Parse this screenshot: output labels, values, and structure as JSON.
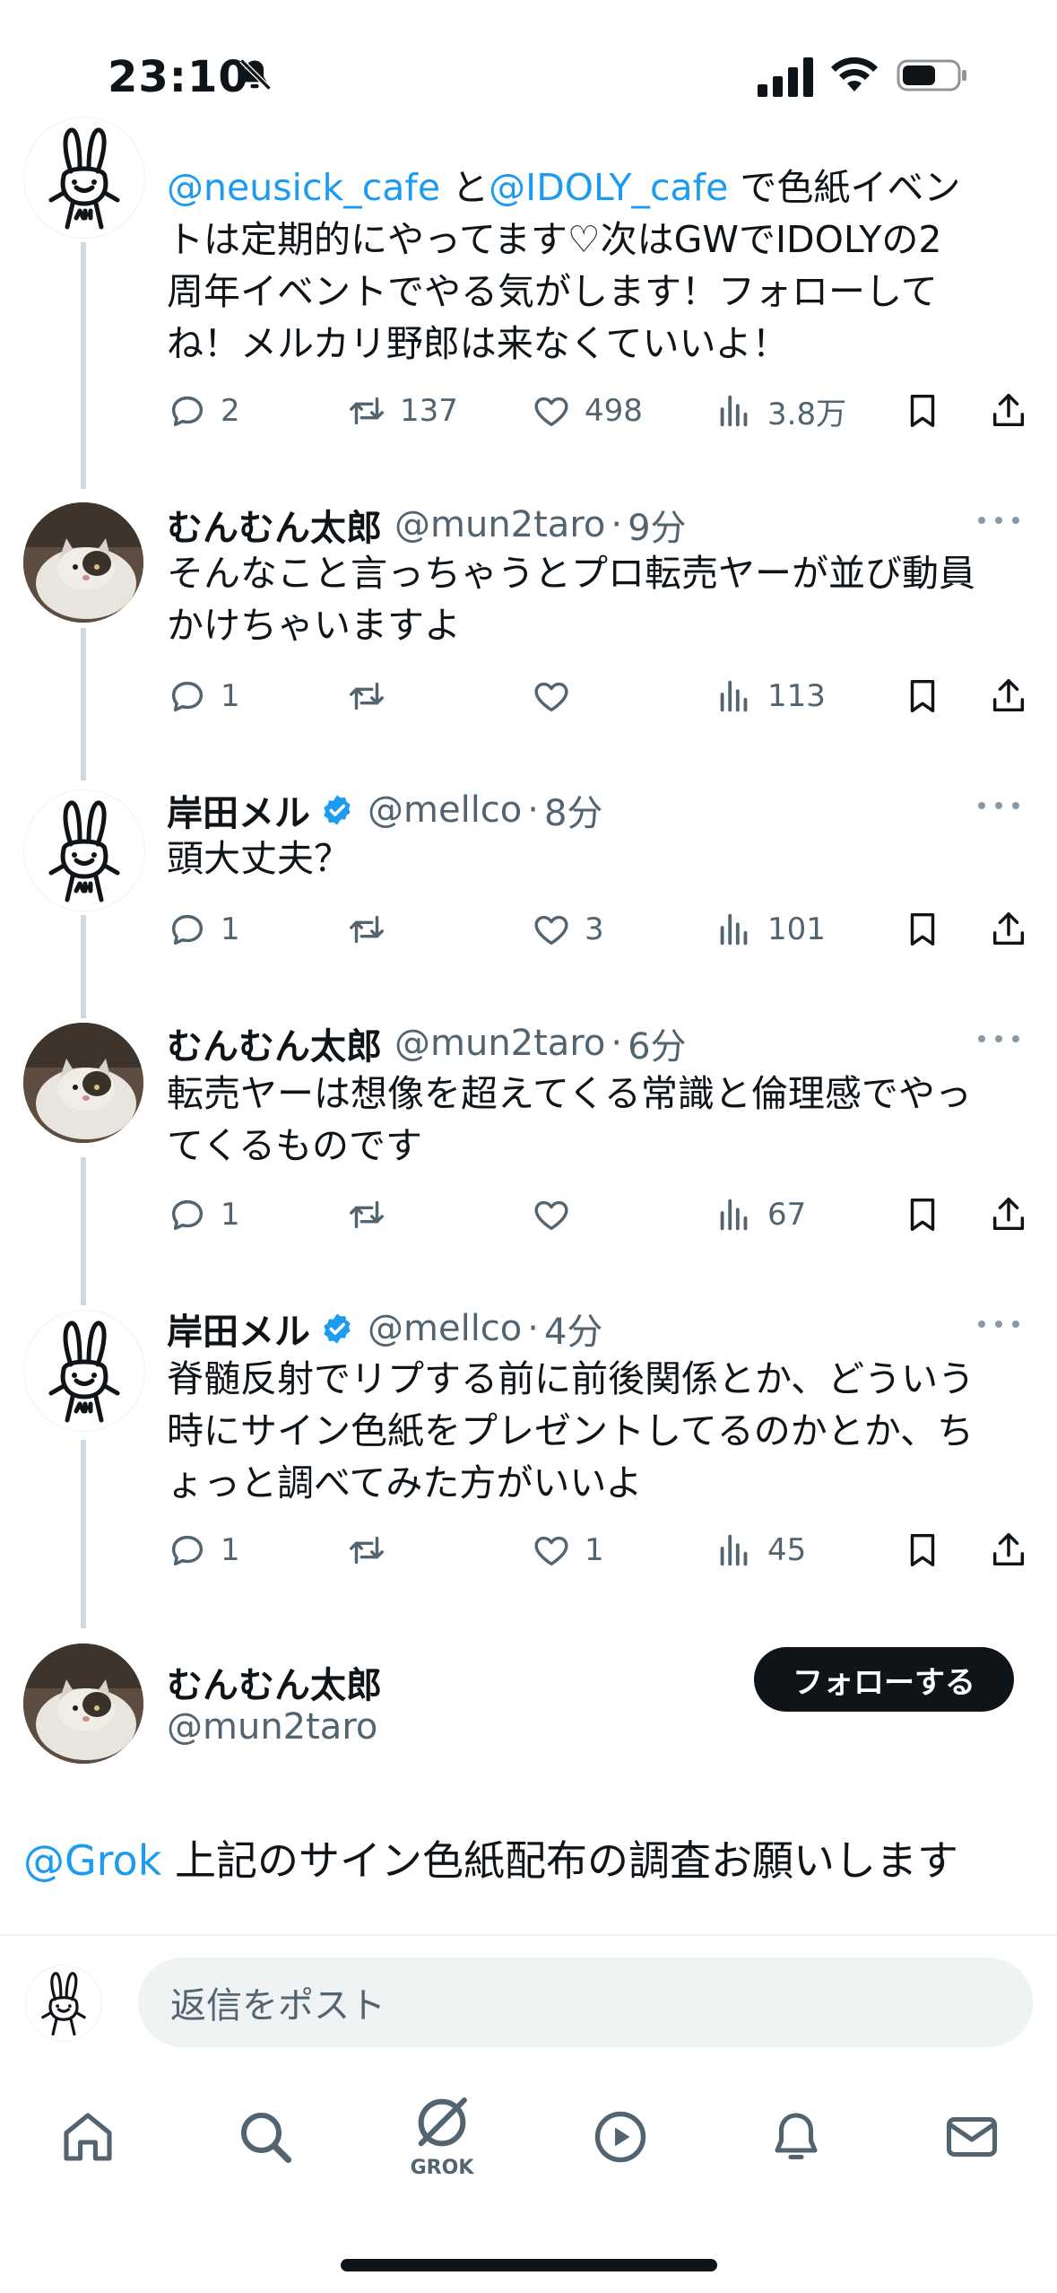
{
  "status": {
    "time": "23:10"
  },
  "top_tweet": {
    "line1_mention1": "@neusick_cafe",
    "line1_mid": " と",
    "line1_mention2": "@IDOLY_cafe",
    "line1_tail": " で色紙イベン",
    "line2": "トは定期的にやってます♡次はGWでIDOLYの2",
    "line3": "周年イベントでやる気がします！フォローして",
    "line4": "ね！メルカリ野郎は来なくていいよ！",
    "replies": "2",
    "retweets": "137",
    "likes": "498",
    "views": "3.8万"
  },
  "tweets": [
    {
      "name": "むんむん太郎",
      "handle": "@mun2taro",
      "time": "9分",
      "lines": [
        "そんなこと言っちゃうとプロ転売ヤーが並び動員",
        "かけちゃいますよ"
      ],
      "replies": "1",
      "retweets": "",
      "likes": "",
      "views": "113"
    },
    {
      "name": "岸田メル",
      "handle": "@mellco",
      "time": "8分",
      "lines": [
        "頭大丈夫？"
      ],
      "replies": "1",
      "retweets": "",
      "likes": "3",
      "views": "101"
    },
    {
      "name": "むんむん太郎",
      "handle": "@mun2taro",
      "time": "6分",
      "lines": [
        "転売ヤーは想像を超えてくる常識と倫理感でやっ",
        "てくるものです"
      ],
      "replies": "1",
      "retweets": "",
      "likes": "",
      "views": "67"
    },
    {
      "name": "岸田メル",
      "handle": "@mellco",
      "time": "4分",
      "lines": [
        "脊髄反射でリプする前に前後関係とか、どういう",
        "時にサイン色紙をプレゼントしてるのかとか、ち",
        "ょっと調べてみた方がいいよ"
      ],
      "replies": "1",
      "retweets": "",
      "likes": "1",
      "views": "45"
    }
  ],
  "main_tweet": {
    "name": "むんむん太郎",
    "handle": "@mun2taro",
    "follow_label": "フォローする",
    "mention": "@Grok",
    "text": " 上記のサイン色紙配布の調査お願いします"
  },
  "reply": {
    "placeholder": "返信をポスト"
  },
  "tabbar": {
    "grok_label": "GROK"
  },
  "colors": {
    "accent": "#1d9bf0",
    "text": "#0f1419",
    "muted": "#536471",
    "verified": "#1d9bf0"
  }
}
